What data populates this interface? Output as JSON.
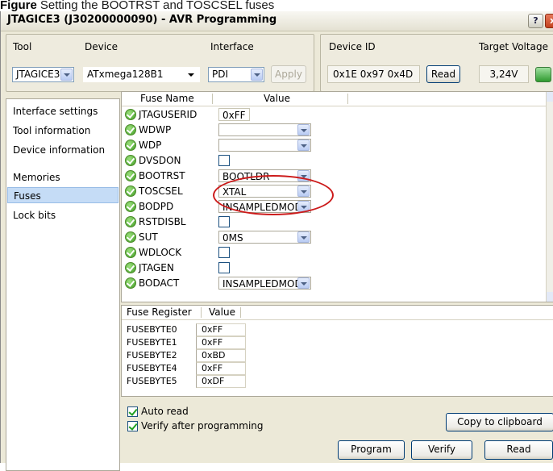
{
  "caption": {
    "label": "Figure",
    "text": "Setting the BOOTRST and TOSCSEL fuses"
  },
  "window": {
    "title": "JTAGICE3 (J30200000090) - AVR Programming",
    "help_glyph": "?",
    "close_glyph": "x"
  },
  "toolbar": {
    "tool_label": "Tool",
    "tool_value": "JTAGICE3",
    "device_label": "Device",
    "device_value": "ATxmega128B1",
    "interface_label": "Interface",
    "interface_value": "PDI",
    "apply_label": "Apply",
    "device_id_label": "Device ID",
    "device_id_value": "0x1E 0x97 0x4D",
    "read_label": "Read",
    "target_voltage_label": "Target Voltage",
    "target_voltage_value": "3,24V"
  },
  "nav": {
    "items": [
      "Interface settings",
      "Tool information",
      "Device information",
      "Memories",
      "Fuses",
      "Lock bits"
    ],
    "selected": "Fuses"
  },
  "fuses": {
    "headers": {
      "name": "Fuse Name",
      "value": "Value"
    },
    "rows": [
      {
        "name": "JTAGUSERID",
        "kind": "text",
        "value": "0xFF"
      },
      {
        "name": "WDWP",
        "kind": "combo",
        "value": ""
      },
      {
        "name": "WDP",
        "kind": "combo",
        "value": ""
      },
      {
        "name": "DVSDON",
        "kind": "check",
        "value": ""
      },
      {
        "name": "BOOTRST",
        "kind": "combo",
        "value": "BOOTLDR"
      },
      {
        "name": "TOSCSEL",
        "kind": "combo",
        "value": "XTAL"
      },
      {
        "name": "BODPD",
        "kind": "combo",
        "value": "INSAMPLEDMODE"
      },
      {
        "name": "RSTDISBL",
        "kind": "check",
        "value": ""
      },
      {
        "name": "SUT",
        "kind": "combo",
        "value": "0MS"
      },
      {
        "name": "WDLOCK",
        "kind": "check",
        "value": ""
      },
      {
        "name": "JTAGEN",
        "kind": "check",
        "value": ""
      },
      {
        "name": "BODACT",
        "kind": "combo",
        "value": "INSAMPLEDMODE"
      }
    ]
  },
  "registers": {
    "headers": {
      "name": "Fuse Register",
      "value": "Value"
    },
    "rows": [
      {
        "name": "FUSEBYTE0",
        "value": "0xFF"
      },
      {
        "name": "FUSEBYTE1",
        "value": "0xFF"
      },
      {
        "name": "FUSEBYTE2",
        "value": "0xBD"
      },
      {
        "name": "FUSEBYTE4",
        "value": "0xFF"
      },
      {
        "name": "FUSEBYTE5",
        "value": "0xDF"
      }
    ]
  },
  "options": {
    "auto_read_label": "Auto read",
    "verify_label": "Verify after programming"
  },
  "actions": {
    "copy_label": "Copy to clipboard",
    "program_label": "Program",
    "verify_label": "Verify",
    "read_label": "Read"
  },
  "colors": {
    "highlight_ellipse": "#cc1b1b",
    "selected_nav": "#c5dcf6",
    "window_bg": "#ece9d8"
  }
}
